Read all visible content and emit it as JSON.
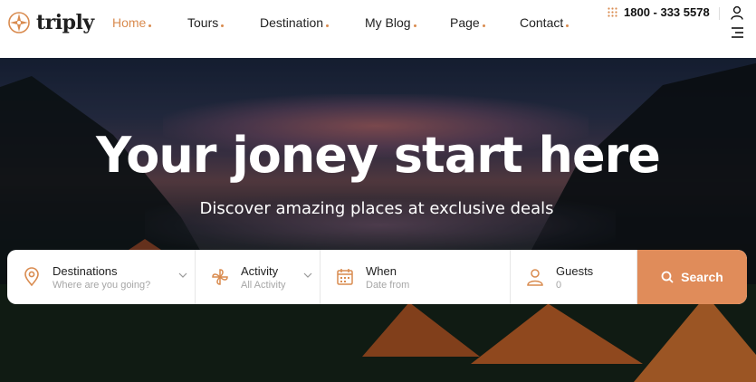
{
  "brand": {
    "name": "triply",
    "icon": "compass-logo-icon"
  },
  "nav": {
    "items": [
      {
        "label": "Home",
        "active": true
      },
      {
        "label": "Tours",
        "active": false
      },
      {
        "label": "Destination",
        "active": false
      },
      {
        "label": "My Blog",
        "active": false
      },
      {
        "label": "Page",
        "active": false
      },
      {
        "label": "Contact",
        "active": false
      }
    ]
  },
  "header": {
    "phone": "1800 - 333 5578",
    "phone_icon": "dial-pad-icon",
    "user_icon": "user-icon",
    "menu_icon": "menu-icon"
  },
  "hero": {
    "title": "Your joney start here",
    "subtitle": "Discover amazing places at exclusive deals"
  },
  "search": {
    "destinations": {
      "label": "Destinations",
      "placeholder": "Where are you going?",
      "icon": "map-pin-icon"
    },
    "activity": {
      "label": "Activity",
      "value": "All Activity",
      "icon": "pinwheel-icon"
    },
    "when": {
      "label": "When",
      "placeholder": "Date from",
      "icon": "calendar-icon"
    },
    "guests": {
      "label": "Guests",
      "value": "0",
      "icon": "user-icon"
    },
    "button_label": "Search"
  },
  "colors": {
    "accent": "#d98b4f",
    "button": "#e08c5a",
    "text": "#222222"
  }
}
